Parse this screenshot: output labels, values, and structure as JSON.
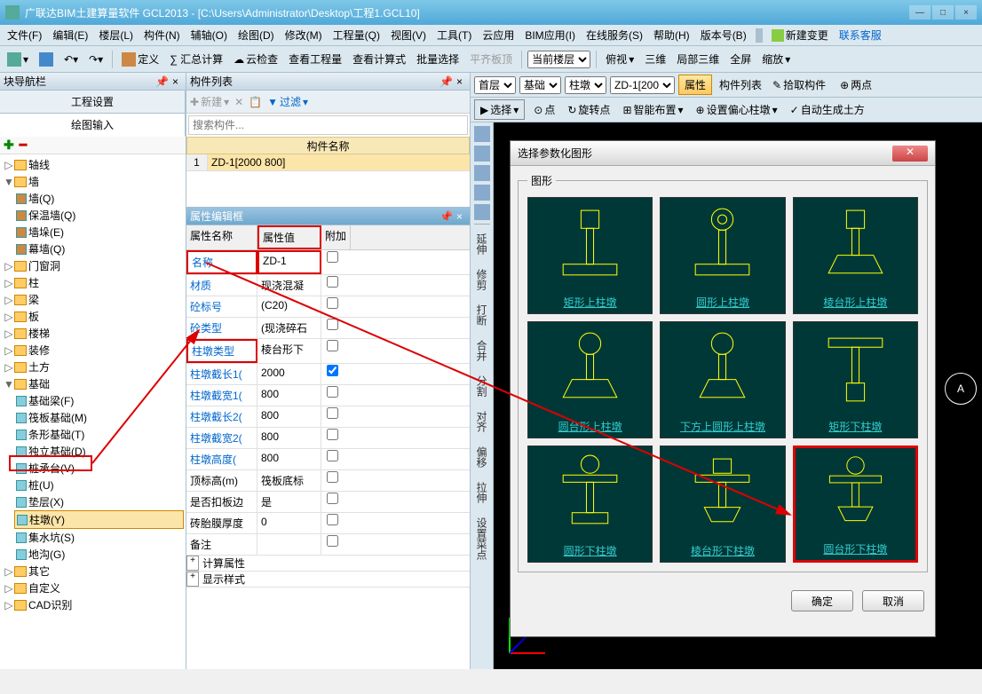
{
  "window": {
    "title": "广联达BIM土建算量软件 GCL2013 - [C:\\Users\\Administrator\\Desktop\\工程1.GCL10]"
  },
  "menu": {
    "items": [
      "文件(F)",
      "编辑(E)",
      "楼层(L)",
      "构件(N)",
      "辅轴(O)",
      "绘图(D)",
      "修改(M)",
      "工程量(Q)",
      "视图(V)",
      "工具(T)",
      "云应用",
      "BIM应用(I)",
      "在线服务(S)",
      "帮助(H)",
      "版本号(B)"
    ],
    "newChange": "新建变更",
    "service": "联系客服"
  },
  "toolbar": {
    "define": "定义",
    "sumCalc": "∑ 汇总计算",
    "cloudCheck": "云检查",
    "viewQty": "查看工程量",
    "viewFormula": "查看计算式",
    "batchSel": "批量选择",
    "alignTop": "平齐板顶",
    "curFloor": "当前楼层",
    "overlook": "俯视",
    "threeD": "三维",
    "localThreeD": "局部三维",
    "fullscreen": "全屏",
    "zoom": "缩放"
  },
  "leftPanel": {
    "title": "块导航栏",
    "tab1": "工程设置",
    "tab2": "绘图输入"
  },
  "tree": {
    "axis": "轴线",
    "wall": "墙",
    "wallQ": "墙(Q)",
    "insWall": "保温墙(Q)",
    "wallHole": "墙垛(E)",
    "curtain": "幕墙(Q)",
    "doorWindow": "门窗洞",
    "column": "柱",
    "beam": "梁",
    "slab": "板",
    "stair": "楼梯",
    "decoration": "装修",
    "earth": "土方",
    "foundation": "基础",
    "foundBeam": "基础梁(F)",
    "raftFound": "筏板基础(M)",
    "stripFound": "条形基础(T)",
    "isoFound": "独立基础(D)",
    "pileCap": "桩承台(V)",
    "pile": "桩(U)",
    "cushion": "垫层(X)",
    "pier": "柱墩(Y)",
    "sump": "集水坑(S)",
    "trench": "地沟(G)",
    "other": "其它",
    "custom": "自定义",
    "cad": "CAD识别"
  },
  "midPanel": {
    "title": "构件列表",
    "newBtn": "新建",
    "filter": "过滤",
    "searchPh": "搜索构件...",
    "hdr": "构件名称",
    "row1": "ZD-1[2000 800]"
  },
  "propPanel": {
    "title": "属性编辑框",
    "col1": "属性名称",
    "col2": "属性值",
    "col3": "附加",
    "rows": [
      {
        "n": "名称",
        "v": "ZD-1"
      },
      {
        "n": "材质",
        "v": "现浇混凝"
      },
      {
        "n": "砼标号",
        "v": "(C20)"
      },
      {
        "n": "砼类型",
        "v": "(现浇碎石"
      },
      {
        "n": "柱墩类型",
        "v": "棱台形下"
      },
      {
        "n": "柱墩截长1(",
        "v": "2000"
      },
      {
        "n": "柱墩截宽1(",
        "v": "800"
      },
      {
        "n": "柱墩截长2(",
        "v": "800"
      },
      {
        "n": "柱墩截宽2(",
        "v": "800"
      },
      {
        "n": "柱墩高度(",
        "v": "800"
      },
      {
        "n": "顶标高(m)",
        "v": "筏板底标"
      },
      {
        "n": "是否扣板边",
        "v": "是"
      },
      {
        "n": "砖胎膜厚度",
        "v": "0"
      },
      {
        "n": "备注",
        "v": ""
      }
    ],
    "calcProp": "计算属性",
    "dispStyle": "显示样式"
  },
  "rightTb1": {
    "floor": "首层",
    "cat": "基础",
    "type": "柱墩",
    "item": "ZD-1[200",
    "prop": "属性",
    "list": "构件列表",
    "pick": "拾取构件",
    "twopt": "两点"
  },
  "rightTb2": {
    "select": "选择",
    "point": "点",
    "rotPoint": "旋转点",
    "smartLayout": "智能布置",
    "offsetPier": "设置偏心柱墩",
    "autoEarth": "自动生成土方"
  },
  "leftTools": {
    "labels": [
      "延伸",
      "修剪",
      "打断",
      "合并",
      "分割",
      "对齐",
      "偏移",
      "拉伸",
      "设置菜点"
    ]
  },
  "dialog": {
    "title": "选择参数化图形",
    "group": "图形",
    "ok": "确定",
    "cancel": "取消",
    "shapes": [
      "矩形上柱墩",
      "圆形上柱墩",
      "棱台形上柱墩",
      "圆台形上柱墩",
      "下方上圆形上柱墩",
      "矩形下柱墩",
      "圆形下柱墩",
      "棱台形下柱墩",
      "圆台形下柱墩"
    ]
  },
  "compass": "A"
}
